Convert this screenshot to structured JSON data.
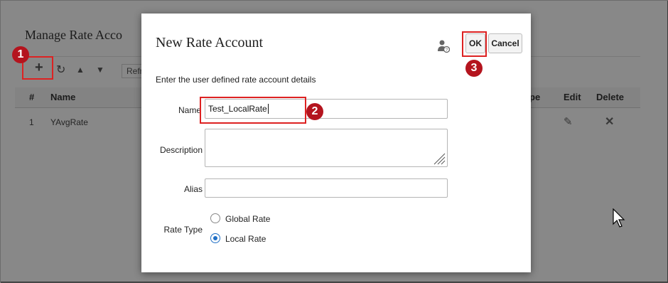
{
  "background": {
    "page_title": "Manage Rate Acco",
    "toolbar_partial": "Refr",
    "columns": [
      "#",
      "Name",
      "pe",
      "Edit",
      "Delete"
    ],
    "rows": [
      {
        "num": "1",
        "name": "YAvgRate"
      }
    ]
  },
  "dialog": {
    "title": "New Rate Account",
    "ok_label": "OK",
    "cancel_label": "Cancel",
    "instruction": "Enter the user defined rate account details",
    "name_label": "Name",
    "name_value": "Test_LocalRate",
    "description_label": "Description",
    "description_value": "",
    "alias_label": "Alias",
    "alias_value": "",
    "rate_type_label": "Rate Type",
    "rate_options": [
      "Global Rate",
      "Local Rate"
    ],
    "selected_rate": "Local Rate"
  },
  "annotations": [
    "1",
    "2",
    "3"
  ],
  "colors": {
    "accent": "#1f6fc5",
    "annotation": "#b4141e",
    "highlight": "#dd2222"
  }
}
